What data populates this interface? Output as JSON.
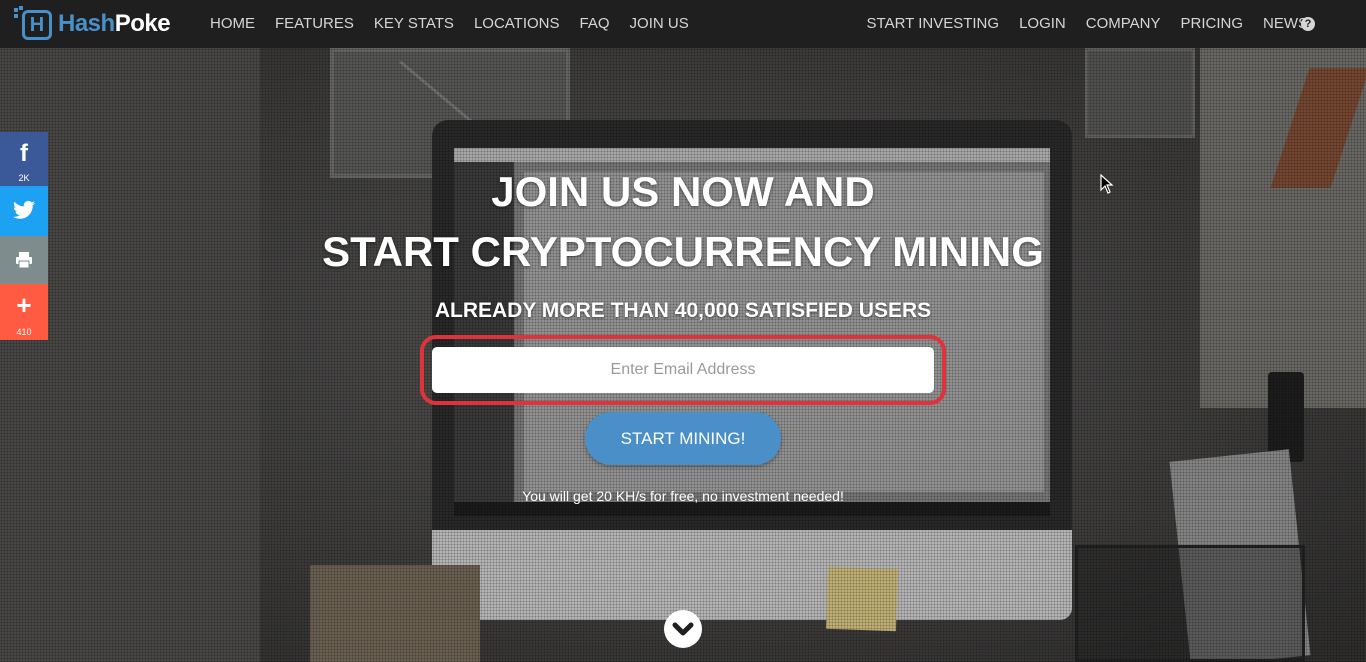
{
  "brand": {
    "name_part1": "Hash",
    "name_part2": "Poke",
    "logo_letter": "H"
  },
  "nav": {
    "left": [
      "HOME",
      "FEATURES",
      "KEY STATS",
      "LOCATIONS",
      "FAQ",
      "JOIN US"
    ],
    "right": [
      "START INVESTING",
      "LOGIN",
      "COMPANY",
      "PRICING",
      "NEWS"
    ],
    "help_glyph": "?"
  },
  "social": {
    "facebook_count": "2K",
    "plus_count": "410"
  },
  "hero": {
    "headline_line1": "JOIN US NOW AND",
    "headline_line2": "START CRYPTOCURRENCY MINING",
    "subhead": "ALREADY MORE THAN 40,000 SATISFIED USERS",
    "email_placeholder": "Enter Email Address",
    "cta_label": "START MINING!",
    "free_note": "You will get 20 KH/s for free, no investment needed!"
  },
  "colors": {
    "brand_blue": "#4a90c8",
    "cta_blue": "#4a8fc7",
    "highlight_red": "#e0323a",
    "facebook": "#3b5998",
    "twitter": "#1da1f2",
    "print": "#7f8c8d",
    "share_plus": "#ff5a42"
  },
  "icons": [
    "facebook-icon",
    "twitter-icon",
    "print-icon",
    "plus-icon",
    "help-icon",
    "chevron-down-icon",
    "mouse-cursor-icon"
  ]
}
